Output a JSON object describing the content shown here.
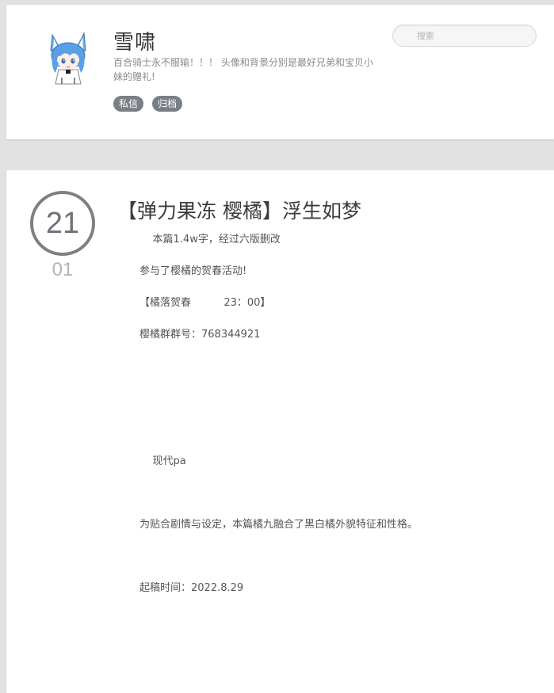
{
  "header": {
    "blog_name": "雪啸",
    "description": "百合骑士永不服输！！！ 头像和背景分别是最好兄弟和宝贝小妹的赠礼!",
    "tags": [
      "私信",
      "归档"
    ],
    "search": {
      "placeholder": "搜索",
      "value": ""
    }
  },
  "post": {
    "day": "21",
    "month": "01",
    "title": "【弹力果冻 樱橘】浮生如梦",
    "paragraphs": [
      "    本篇1.4w字，经过六版删改",
      "参与了樱橘的贺春活动!",
      "【橘落贺春          23：00】",
      "樱橘群群号：768344921",
      "    现代pa",
      "为贴合剧情与设定，本篇橘九融合了黑白橘外貌特征和性格。",
      "起稿时间：2022.8.29"
    ]
  },
  "colors": {
    "background": "#e2e2e2",
    "card": "#ffffff",
    "tag_bg": "#7a7f85",
    "date_ring": "#7a8086",
    "avatar_hair": "#5aa0e6"
  }
}
